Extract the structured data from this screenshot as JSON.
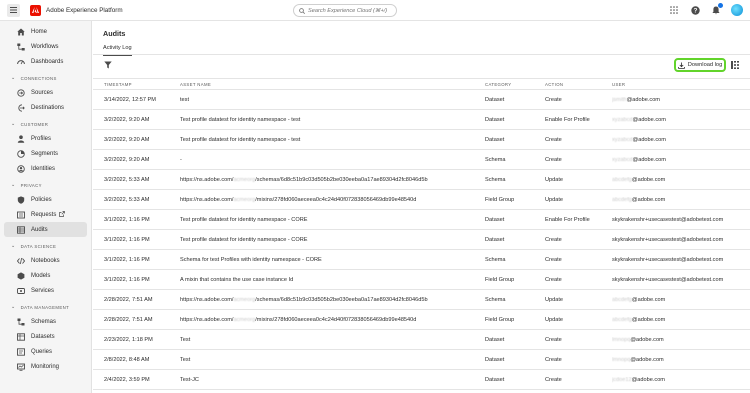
{
  "topbar": {
    "app_title": "Adobe Experience Platform",
    "search_placeholder": "Search Experience Cloud (⌘+/)"
  },
  "sidebar": {
    "top_items": [
      {
        "label": "Home",
        "icon": "home-icon"
      },
      {
        "label": "Workflows",
        "icon": "workflows-icon"
      },
      {
        "label": "Dashboards",
        "icon": "dashboards-icon"
      }
    ],
    "sections": [
      {
        "title": "CONNECTIONS",
        "items": [
          {
            "label": "Sources",
            "icon": "sources-icon"
          },
          {
            "label": "Destinations",
            "icon": "destinations-icon"
          }
        ]
      },
      {
        "title": "CUSTOMER",
        "items": [
          {
            "label": "Profiles",
            "icon": "profiles-icon"
          },
          {
            "label": "Segments",
            "icon": "segments-icon"
          },
          {
            "label": "Identities",
            "icon": "identities-icon"
          }
        ]
      },
      {
        "title": "PRIVACY",
        "items": [
          {
            "label": "Policies",
            "icon": "policies-icon"
          },
          {
            "label": "Requests",
            "icon": "requests-icon"
          },
          {
            "label": "Audits",
            "icon": "audits-icon",
            "active": true
          }
        ]
      },
      {
        "title": "DATA SCIENCE",
        "items": [
          {
            "label": "Notebooks",
            "icon": "notebooks-icon"
          },
          {
            "label": "Models",
            "icon": "models-icon"
          },
          {
            "label": "Services",
            "icon": "services-icon"
          }
        ]
      },
      {
        "title": "DATA MANAGEMENT",
        "items": [
          {
            "label": "Schemas",
            "icon": "schemas-icon"
          },
          {
            "label": "Datasets",
            "icon": "datasets-icon"
          },
          {
            "label": "Queries",
            "icon": "queries-icon"
          },
          {
            "label": "Monitoring",
            "icon": "monitoring-icon"
          }
        ]
      }
    ]
  },
  "main": {
    "title": "Audits",
    "tab": "Activity Log",
    "download_label": "Download log",
    "highlight_color": "#62d42b"
  },
  "table": {
    "headers": [
      "TIMESTAMP",
      "ASSET NAME",
      "CATEGORY",
      "ACTION",
      "USER"
    ],
    "rows": [
      {
        "ts": "3/14/2022, 12:57 PM",
        "asset": "test",
        "cat": "Dataset",
        "act": "Create",
        "user_hidden": "jsmith",
        "user_suffix": "@adobe.com"
      },
      {
        "ts": "3/2/2022, 9:20 AM",
        "asset": "Test profile datatest for identity namespace - test",
        "cat": "Dataset",
        "act": "Enable For Profile",
        "user_hidden": "xyzabcd",
        "user_suffix": "@adobe.com"
      },
      {
        "ts": "3/2/2022, 9:20 AM",
        "asset": "Test profile datatest for identity namespace - test",
        "cat": "Dataset",
        "act": "Create",
        "user_hidden": "xyzabcd",
        "user_suffix": "@adobe.com"
      },
      {
        "ts": "3/2/2022, 9:20 AM",
        "asset": "-",
        "cat": "Schema",
        "act": "Create",
        "user_hidden": "xyzabcd",
        "user_suffix": "@adobe.com"
      },
      {
        "ts": "3/2/2022, 5:33 AM",
        "asset_prefix": "https://ns.adobe.com/",
        "asset_hidden": "acmeorg",
        "asset_suffix": "/schemas/6d8c51b9c03d505b2be030eeba0a17ae89304d2fc8046d5b",
        "cat": "Schema",
        "act": "Update",
        "user_hidden": "abcdefg",
        "user_suffix": "@adobe.com"
      },
      {
        "ts": "3/2/2022, 5:33 AM",
        "asset_prefix": "https://ns.adobe.com/",
        "asset_hidden": "acmeorg",
        "asset_suffix": "/mixins/278fd060aeceea0c4c24d40f072838056469db99e48540d",
        "cat": "Field Group",
        "act": "Update",
        "user_hidden": "abcdefg",
        "user_suffix": "@adobe.com"
      },
      {
        "ts": "3/1/2022, 1:16 PM",
        "asset": "Test profile datatest for identity namespace - CORE",
        "cat": "Dataset",
        "act": "Enable For Profile",
        "user": "skykrakenshr+usecasestest@adobetest.com"
      },
      {
        "ts": "3/1/2022, 1:16 PM",
        "asset": "Test profile datatest for identity namespace - CORE",
        "cat": "Dataset",
        "act": "Create",
        "user": "skykrakenshr+usecasestest@adobetest.com"
      },
      {
        "ts": "3/1/2022, 1:16 PM",
        "asset": "Schema for test Profiles with identity namespace - CORE",
        "cat": "Schema",
        "act": "Create",
        "user": "skykrakenshr+usecasestest@adobetest.com"
      },
      {
        "ts": "3/1/2022, 1:16 PM",
        "asset": "A mixin that contains the use case instance Id",
        "cat": "Field Group",
        "act": "Create",
        "user": "skykrakenshr+usecasestest@adobetest.com"
      },
      {
        "ts": "2/28/2022, 7:51 AM",
        "asset_prefix": "https://ns.adobe.com/",
        "asset_hidden": "acmeorg",
        "asset_suffix": "/schemas/6d8c51b9c03d505b2be030eeba0a17ae89304d2fc8046d5b",
        "cat": "Schema",
        "act": "Update",
        "user_hidden": "abcdefg",
        "user_suffix": "@adobe.com"
      },
      {
        "ts": "2/28/2022, 7:51 AM",
        "asset_prefix": "https://ns.adobe.com/",
        "asset_hidden": "acmeorg",
        "asset_suffix": "/mixins/278fd060aeceea0c4c24d40f072838056469db99e48540d",
        "cat": "Field Group",
        "act": "Update",
        "user_hidden": "abcdefg",
        "user_suffix": "@adobe.com"
      },
      {
        "ts": "2/23/2022, 1:18 PM",
        "asset": "Test",
        "cat": "Dataset",
        "act": "Create",
        "user_hidden": "lmnopq",
        "user_suffix": "@adobe.com"
      },
      {
        "ts": "2/8/2022, 8:48 AM",
        "asset": "Test",
        "cat": "Dataset",
        "act": "Create",
        "user_hidden": "lmnopq",
        "user_suffix": "@adobe.com"
      },
      {
        "ts": "2/4/2022, 3:59 PM",
        "asset": "Test-JC",
        "cat": "Dataset",
        "act": "Create",
        "user_hidden": "jcdoe12",
        "user_suffix": "@adobe.com"
      }
    ]
  }
}
